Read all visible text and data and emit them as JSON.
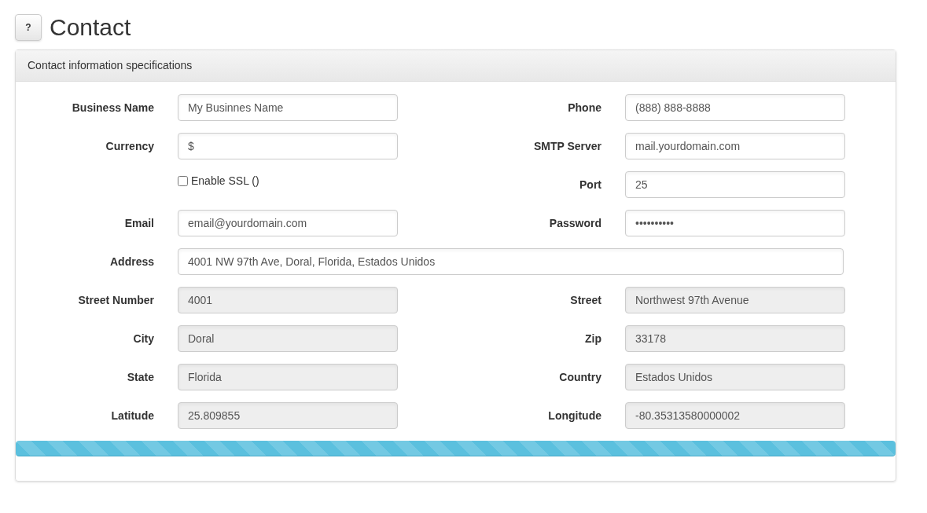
{
  "page": {
    "help_button": "?",
    "title": "Contact"
  },
  "panel": {
    "heading": "Contact information specifications",
    "rows": [
      {
        "kind": "pair",
        "cells": [
          {
            "kind": "field",
            "label": "Business Name",
            "value": "My Businnes Name",
            "disabled": false
          },
          {
            "kind": "field",
            "label": "Phone",
            "value": "(888) 888-8888",
            "disabled": false
          }
        ]
      },
      {
        "kind": "pair",
        "cells": [
          {
            "kind": "field",
            "label": "Currency",
            "value": "$",
            "disabled": false
          },
          {
            "kind": "field",
            "label": "SMTP Server",
            "value": "mail.yourdomain.com",
            "disabled": false
          }
        ]
      },
      {
        "kind": "pair",
        "cells": [
          {
            "kind": "checkbox",
            "label": "Enable SSL ()",
            "checked": false
          },
          {
            "kind": "field",
            "label": "Port",
            "value": "25",
            "disabled": false
          }
        ]
      },
      {
        "kind": "pair",
        "cells": [
          {
            "kind": "field",
            "label": "Email",
            "value": "email@yourdomain.com",
            "disabled": false
          },
          {
            "kind": "field",
            "label": "Password",
            "value": "••••••••••",
            "disabled": false
          }
        ]
      },
      {
        "kind": "wide",
        "cells": [
          {
            "kind": "field",
            "label": "Address",
            "value": "4001 NW 97th Ave, Doral, Florida, Estados Unidos",
            "disabled": false
          }
        ]
      },
      {
        "kind": "pair",
        "cells": [
          {
            "kind": "field",
            "label": "Street Number",
            "value": "4001",
            "disabled": true
          },
          {
            "kind": "field",
            "label": "Street",
            "value": "Northwest 97th Avenue",
            "disabled": true
          }
        ]
      },
      {
        "kind": "pair",
        "cells": [
          {
            "kind": "field",
            "label": "City",
            "value": "Doral",
            "disabled": true
          },
          {
            "kind": "field",
            "label": "Zip",
            "value": "33178",
            "disabled": true
          }
        ]
      },
      {
        "kind": "pair",
        "cells": [
          {
            "kind": "field",
            "label": "State",
            "value": "Florida",
            "disabled": true
          },
          {
            "kind": "field",
            "label": "Country",
            "value": "Estados Unidos",
            "disabled": true
          }
        ]
      },
      {
        "kind": "pair",
        "cells": [
          {
            "kind": "field",
            "label": "Latitude",
            "value": "25.809855",
            "disabled": true
          },
          {
            "kind": "field",
            "label": "Longitude",
            "value": "-80.35313580000002",
            "disabled": true
          }
        ]
      }
    ],
    "progress": {
      "level": 1
    }
  }
}
